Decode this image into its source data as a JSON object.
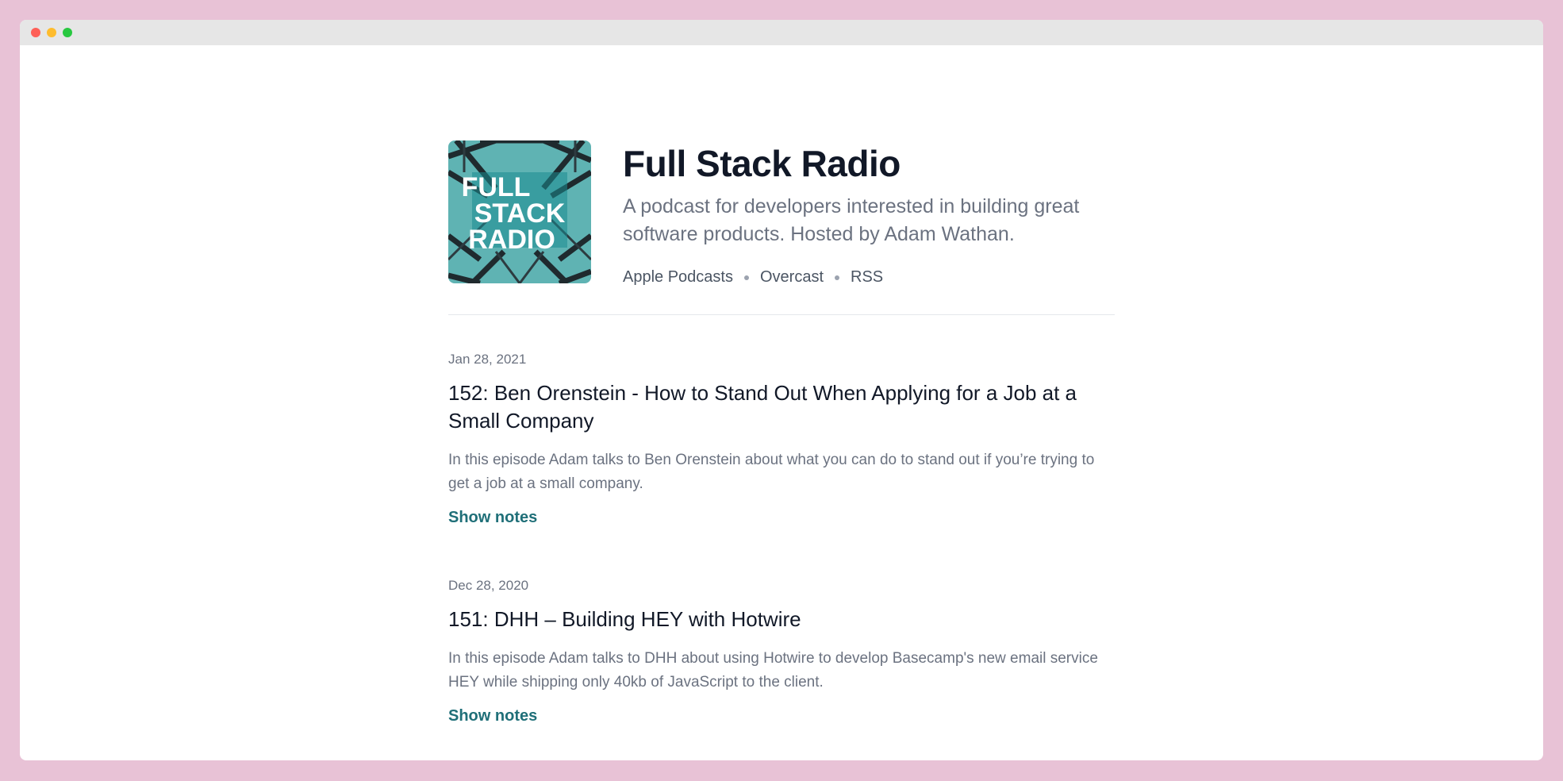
{
  "podcast": {
    "cover_lines": [
      "FULL",
      "STACK",
      "RADIO"
    ],
    "title": "Full Stack Radio",
    "subtitle": "A podcast for developers interested in building great software products. Hosted by Adam Wathan.",
    "links": [
      "Apple Podcasts",
      "Overcast",
      "RSS"
    ]
  },
  "episodes": [
    {
      "date": "Jan 28, 2021",
      "title": "152: Ben Orenstein - How to Stand Out When Applying for a Job at a Small Company",
      "description": "In this episode Adam talks to Ben Orenstein about what you can do to stand out if you’re trying to get a job at a small company.",
      "link_label": "Show notes"
    },
    {
      "date": "Dec 28, 2020",
      "title": "151: DHH – Building HEY with Hotwire",
      "description": "In this episode Adam talks to DHH about using Hotwire to develop Basecamp's new email service HEY while shipping only 40kb of JavaScript to the client.",
      "link_label": "Show notes"
    }
  ],
  "colors": {
    "accent": "#1f6f78",
    "background": "#e8c2d6",
    "cover_teal": "#5fb3b3"
  }
}
